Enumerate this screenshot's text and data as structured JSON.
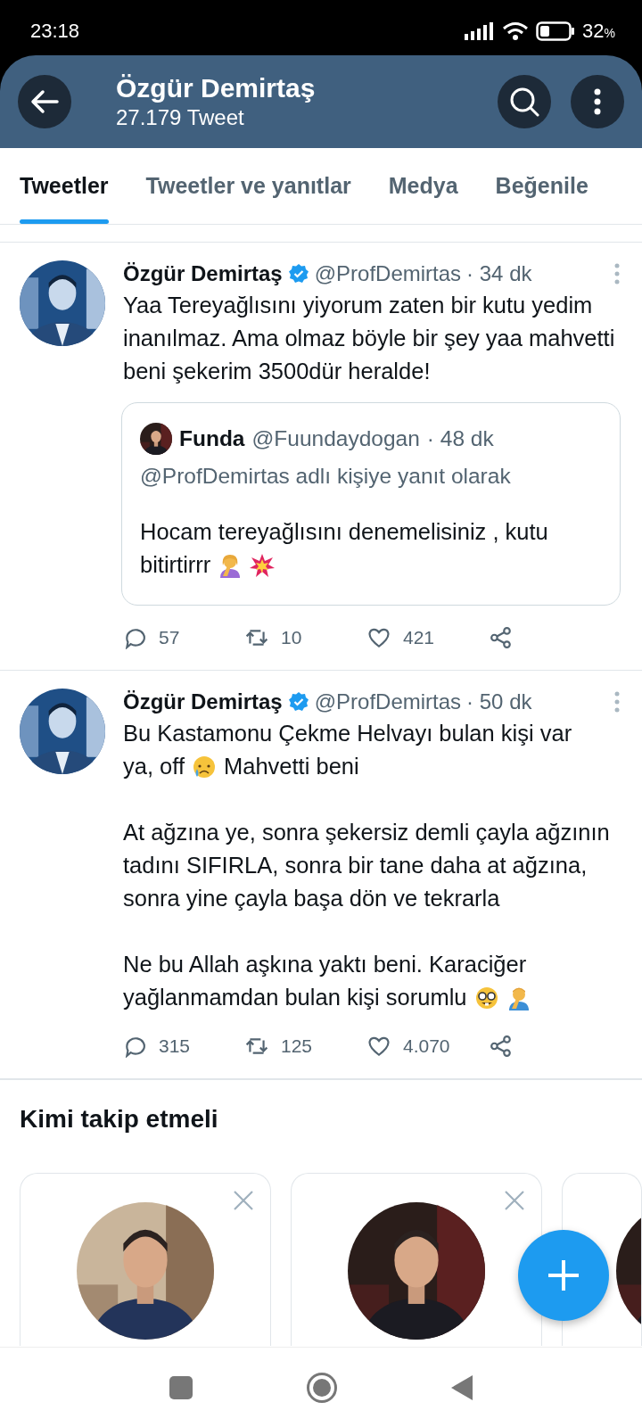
{
  "status_bar": {
    "time": "23:18",
    "battery": "32",
    "percent_sign": "%"
  },
  "header": {
    "title": "Özgür Demirtaş",
    "subtitle": "27.179 Tweet"
  },
  "tabs": [
    {
      "label": "Tweetler",
      "selected": true
    },
    {
      "label": "Tweetler ve yanıtlar",
      "selected": false
    },
    {
      "label": "Medya",
      "selected": false
    },
    {
      "label": "Beğenile",
      "selected": false
    }
  ],
  "tweets": [
    {
      "author": {
        "name": "Özgür Demirtaş",
        "verified": true,
        "handle": "@ProfDemirtas",
        "time": "· 34 dk"
      },
      "body": [
        {
          "kind": "text",
          "text": "Yaa Tereyağlısını yiyorum zaten bir kutu yedim inanılmaz. Ama olmaz böyle bir şey yaa mahvetti beni şekerim 3500dür heralde!"
        }
      ],
      "quote": {
        "author": {
          "name": "Funda",
          "handle": "@Fuundaydogan",
          "time": "· 48 dk"
        },
        "reply_to": "@ProfDemirtas adlı kişiye yanıt olarak",
        "body": [
          {
            "kind": "mixed",
            "lines": [
              [
                {
                  "kind": "text",
                  "text": "Hocam tereyağlısını denemelisiniz , kutu"
                }
              ],
              [
                {
                  "kind": "text",
                  "text": "bitirtirrr"
                },
                {
                  "kind": "woman-facepalm"
                },
                {
                  "kind": "collision"
                }
              ]
            ]
          }
        ]
      },
      "actions": {
        "replies": "57",
        "retweets": "10",
        "likes": "421"
      }
    },
    {
      "author": {
        "name": "Özgür Demirtaş",
        "verified": true,
        "handle": "@ProfDemirtas",
        "time": "· 50 dk"
      },
      "body": [
        {
          "kind": "mixed",
          "lines": [
            [
              {
                "kind": "text",
                "text": "Bu Kastamonu Çekme Helvayı bulan kişi var"
              }
            ],
            [
              {
                "kind": "text",
                "text": "ya, off"
              },
              {
                "kind": "crying-face"
              },
              {
                "kind": "text",
                "text": "Mahvetti beni"
              }
            ]
          ]
        },
        {
          "kind": "text",
          "text": "At ağzına ye, sonra şekersiz demli çayla ağzının tadını SIFIRLA, sonra bir tane daha at ağzına, sonra yine çayla başa dön ve tekrarla"
        },
        {
          "kind": "mixed",
          "lines": [
            [
              {
                "kind": "text",
                "text": "Ne bu Allah aşkına yaktı beni. Karaciğer"
              }
            ],
            [
              {
                "kind": "text",
                "text": "yağlanmamdan bulan kişi sorumlu"
              },
              {
                "kind": "nerd-face"
              },
              {
                "kind": "man-facepalm"
              }
            ]
          ]
        }
      ],
      "actions": {
        "replies": "315",
        "retweets": "125",
        "likes": "4.070"
      }
    }
  ],
  "suggestions": {
    "title": "Kimi takip etmeli",
    "cards": [
      {
        "dismissible": true,
        "avatar": {
          "kind": "picture"
        }
      },
      {
        "dismissible": true,
        "avatar": {
          "kind": "picture"
        }
      },
      {
        "avatar": {
          "kind": "picture"
        }
      }
    ]
  }
}
